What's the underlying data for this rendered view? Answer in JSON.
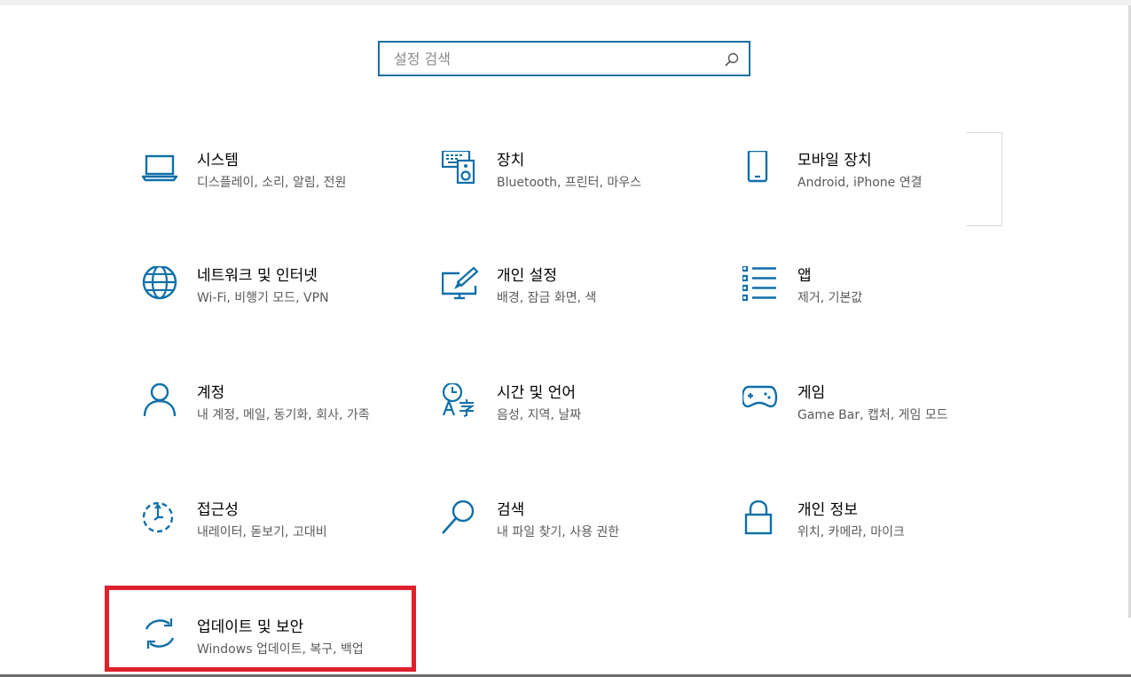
{
  "search": {
    "placeholder": "설정 검색"
  },
  "tiles": [
    {
      "icon": "laptop-icon",
      "title": "시스템",
      "subtitle": "디스플레이, 소리, 알림, 전원"
    },
    {
      "icon": "devices-icon",
      "title": "장치",
      "subtitle": "Bluetooth, 프린터, 마우스"
    },
    {
      "icon": "phone-icon",
      "title": "모바일 장치",
      "subtitle": "Android, iPhone 연결"
    },
    {
      "icon": "globe-icon",
      "title": "네트워크 및 인터넷",
      "subtitle": "Wi-Fi, 비행기 모드, VPN"
    },
    {
      "icon": "personalization-icon",
      "title": "개인 설정",
      "subtitle": "배경, 잠금 화면, 색"
    },
    {
      "icon": "apps-list-icon",
      "title": "앱",
      "subtitle": "제거, 기본값"
    },
    {
      "icon": "person-icon",
      "title": "계정",
      "subtitle": "내 계정, 메일, 동기화, 회사, 가족"
    },
    {
      "icon": "time-language-icon",
      "title": "시간 및 언어",
      "subtitle": "음성, 지역, 날짜"
    },
    {
      "icon": "gamepad-icon",
      "title": "게임",
      "subtitle": "Game Bar, 캡처, 게임 모드"
    },
    {
      "icon": "accessibility-icon",
      "title": "접근성",
      "subtitle": "내레이터, 돋보기, 고대비"
    },
    {
      "icon": "search-magnifier-icon",
      "title": "검색",
      "subtitle": "내 파일 찾기, 사용 권한"
    },
    {
      "icon": "lock-icon",
      "title": "개인 정보",
      "subtitle": "위치, 카메라, 마이크"
    },
    {
      "icon": "sync-icon",
      "title": "업데이트 및 보안",
      "subtitle": "Windows 업데이트, 복구, 백업"
    }
  ],
  "colors": {
    "accent": "#0e6fa8",
    "highlight": "#e0202a",
    "subtitle": "#5a5a5a"
  }
}
